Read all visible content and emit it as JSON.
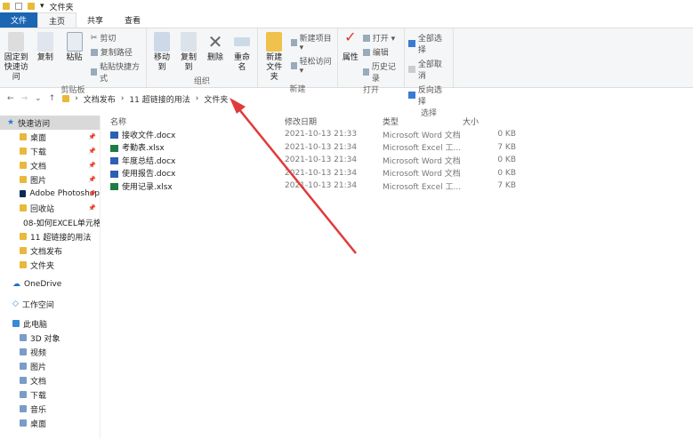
{
  "window": {
    "title": "文件夹"
  },
  "tabs": [
    "文件",
    "主页",
    "共享",
    "查看"
  ],
  "ribbon": {
    "clipboard": {
      "label": "剪贴板",
      "pin": "固定到快速访问",
      "copy": "复制",
      "paste": "粘贴",
      "cut": "剪切",
      "copy_path": "复制路径",
      "paste_shortcut": "粘贴快捷方式"
    },
    "organize": {
      "label": "组织",
      "move_to": "移动到",
      "copy_to": "复制到",
      "delete": "删除",
      "rename": "重命名"
    },
    "new": {
      "label": "新建",
      "new_folder": "新建文件夹",
      "new_item": "新建项目 ▾",
      "easy_access": "轻松访问 ▾"
    },
    "open": {
      "label": "打开",
      "properties": "属性",
      "open": "打开 ▾",
      "edit": "编辑",
      "history": "历史记录"
    },
    "select": {
      "label": "选择",
      "select_all": "全部选择",
      "select_none": "全部取消",
      "invert": "反向选择"
    }
  },
  "address": {
    "crumbs": [
      "文档发布",
      "11 超链接的用法",
      "文件夹"
    ]
  },
  "sidebar": {
    "quick_access": "快速访问",
    "pinned": [
      "桌面",
      "下载",
      "文档",
      "图片",
      "Adobe Photoshop",
      "回收站"
    ],
    "recent": [
      "08-如何EXCEL单元格",
      "11 超链接的用法",
      "文档发布",
      "文件夹"
    ],
    "onedrive": "OneDrive",
    "workspace": "工作空间",
    "this_pc": "此电脑",
    "pc_items": [
      "3D 对象",
      "视频",
      "图片",
      "文档",
      "下载",
      "音乐",
      "桌面"
    ]
  },
  "columns": [
    "名称",
    "修改日期",
    "类型",
    "大小"
  ],
  "files": [
    {
      "name": "接收文件.docx",
      "date": "2021-10-13 21:33",
      "type": "Microsoft Word 文档",
      "size": "0 KB",
      "kind": "word"
    },
    {
      "name": "考勤表.xlsx",
      "date": "2021-10-13 21:34",
      "type": "Microsoft Excel 工...",
      "size": "7 KB",
      "kind": "excel"
    },
    {
      "name": "年度总结.docx",
      "date": "2021-10-13 21:34",
      "type": "Microsoft Word 文档",
      "size": "0 KB",
      "kind": "word"
    },
    {
      "name": "使用报告.docx",
      "date": "2021-10-13 21:34",
      "type": "Microsoft Word 文档",
      "size": "0 KB",
      "kind": "word"
    },
    {
      "name": "使用记录.xlsx",
      "date": "2021-10-13 21:34",
      "type": "Microsoft Excel 工...",
      "size": "7 KB",
      "kind": "excel"
    }
  ],
  "colors": {
    "accent": "#1a66b3",
    "arrow": "#e03a3a"
  }
}
